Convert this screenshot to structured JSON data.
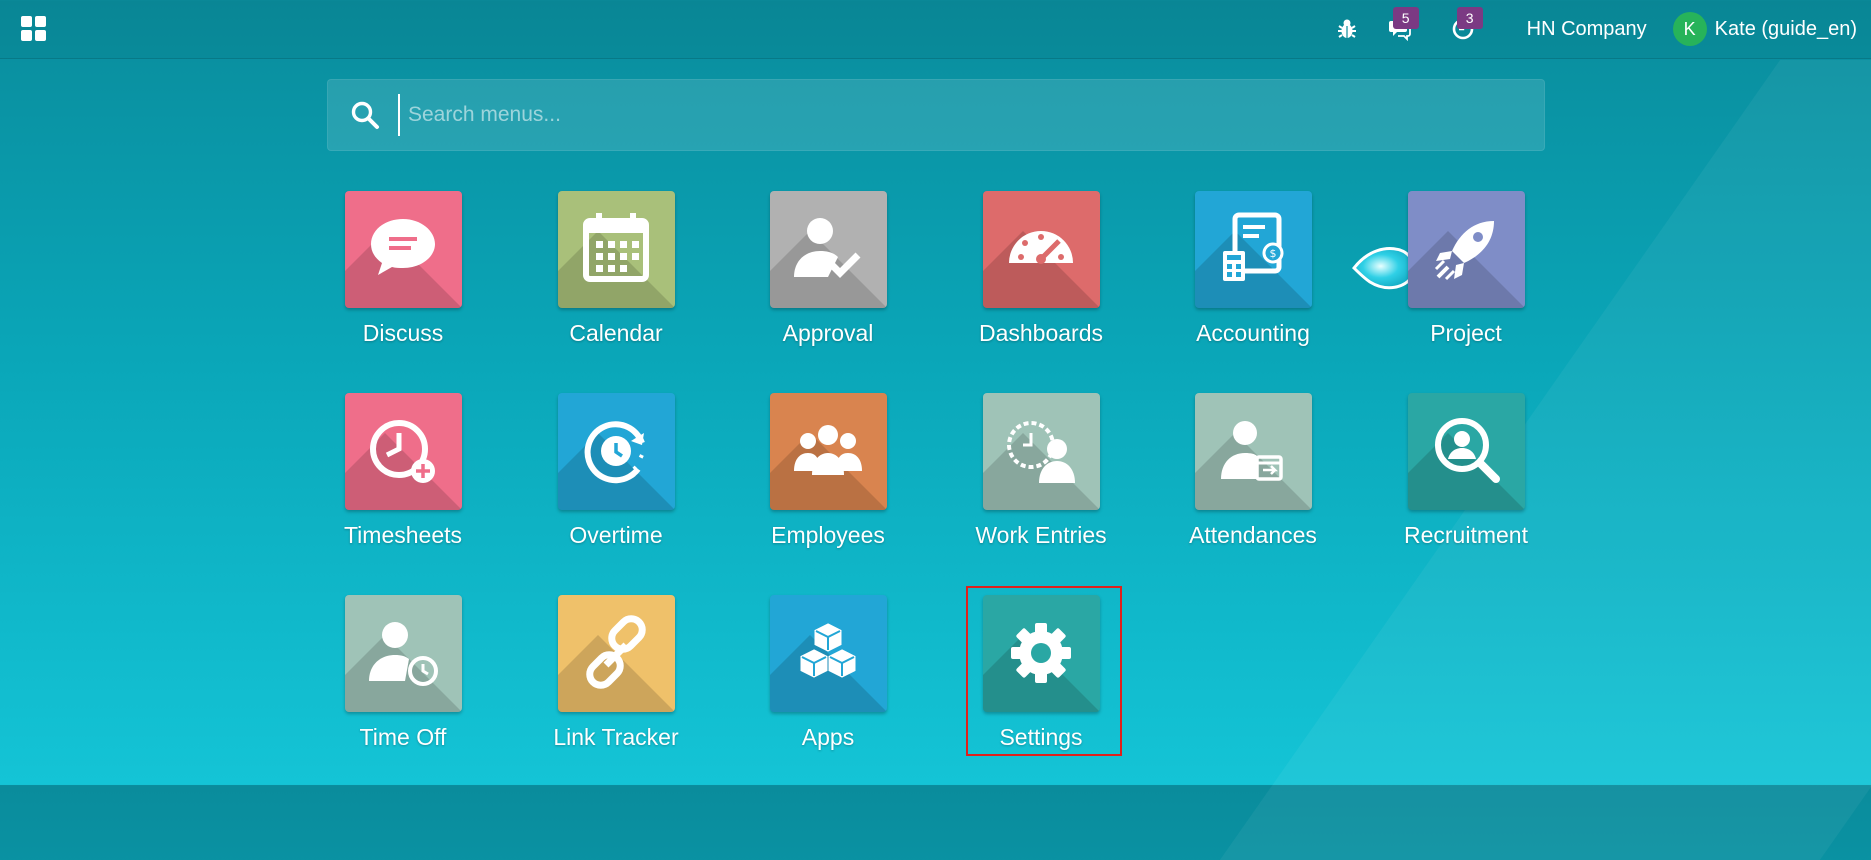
{
  "topbar": {
    "discuss_count": "5",
    "activity_count": "3",
    "company": "HN Company",
    "user_initial": "K",
    "user_name": "Kate (guide_en)"
  },
  "search": {
    "placeholder": "Search menus..."
  },
  "apps": [
    {
      "label": "Discuss",
      "color": "#ef6e8a",
      "icon": "chat-bubble-icon"
    },
    {
      "label": "Calendar",
      "color": "#a9c07a",
      "icon": "calendar-icon"
    },
    {
      "label": "Approval",
      "color": "#b1b1b1",
      "icon": "person-check-icon"
    },
    {
      "label": "Dashboards",
      "color": "#dd6b6b",
      "icon": "speedometer-icon"
    },
    {
      "label": "Accounting",
      "color": "#22a6d6",
      "icon": "invoice-calculator-icon"
    },
    {
      "label": "Project",
      "color": "#7f8dc7",
      "icon": "rocket-icon"
    },
    {
      "label": "Timesheets",
      "color": "#ef6e8a",
      "icon": "clock-plus-icon"
    },
    {
      "label": "Overtime",
      "color": "#22a6d6",
      "icon": "clock-cycle-icon"
    },
    {
      "label": "Employees",
      "color": "#d9844f",
      "icon": "people-group-icon"
    },
    {
      "label": "Work Entries",
      "color": "#9fc3b7",
      "icon": "clock-person-icon"
    },
    {
      "label": "Attendances",
      "color": "#9fc3b7",
      "icon": "person-calendar-icon"
    },
    {
      "label": "Recruitment",
      "color": "#2aa7a4",
      "icon": "person-search-icon"
    },
    {
      "label": "Time Off",
      "color": "#9fc3b7",
      "icon": "person-clock-icon"
    },
    {
      "label": "Link Tracker",
      "color": "#efc16a",
      "icon": "chain-link-icon"
    },
    {
      "label": "Apps",
      "color": "#22a6d6",
      "icon": "cubes-icon"
    },
    {
      "label": "Settings",
      "color": "#2aa7a4",
      "icon": "gear-icon"
    }
  ]
}
